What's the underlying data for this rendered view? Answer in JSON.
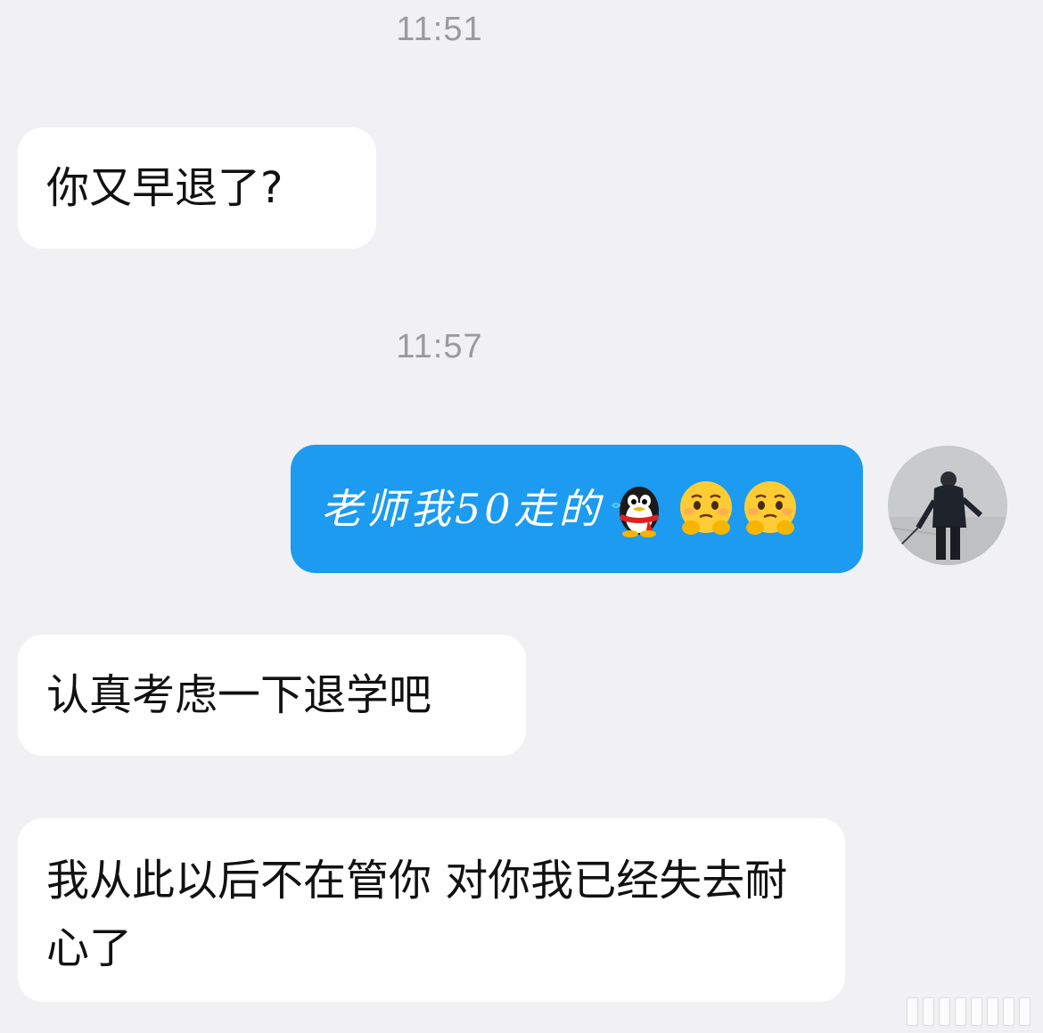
{
  "timestamps": [
    "11:51",
    "11:57"
  ],
  "messages": [
    {
      "id": "msg-1",
      "direction": "incoming",
      "text": "你又早退了?"
    },
    {
      "id": "msg-2",
      "direction": "outgoing",
      "text": "老师我50走的",
      "emojis": [
        "qq-penguin-icon",
        "pleading-face-icon",
        "pleading-face-icon"
      ]
    },
    {
      "id": "msg-3",
      "direction": "incoming",
      "text": "认真考虑一下退学吧"
    },
    {
      "id": "msg-4",
      "direction": "incoming",
      "text": "我从此以后不在管你 对你我已经失去耐心了"
    }
  ],
  "colors": {
    "background": "#f1f1f3",
    "incoming_bubble": "#ffffff",
    "outgoing_bubble": "#1c9bf0",
    "timestamp": "#9a9aa0"
  }
}
